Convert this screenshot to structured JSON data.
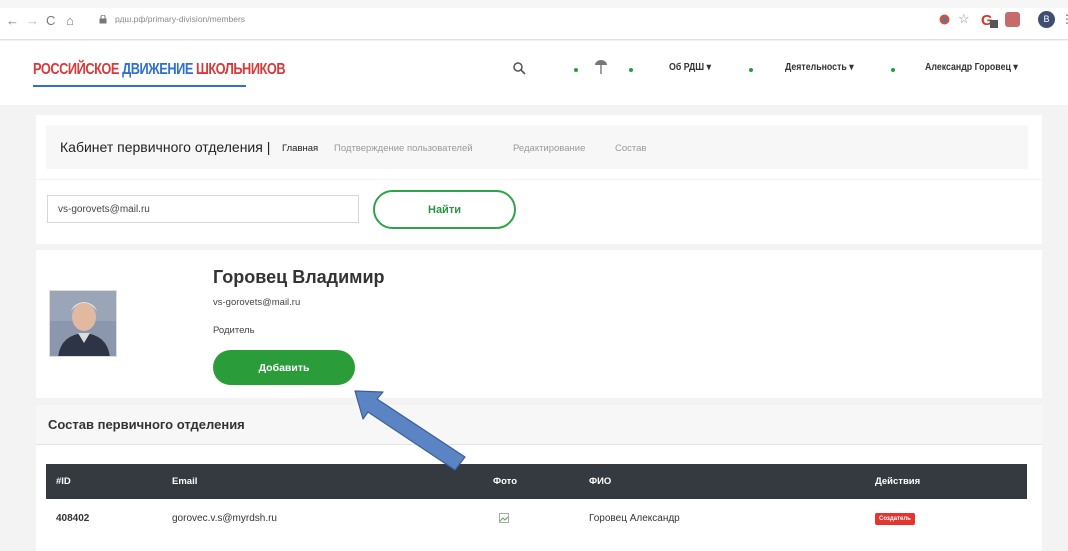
{
  "browser": {
    "url": "рдш.рф/primary-division/members",
    "nav": {
      "back": "←",
      "forward": "→",
      "reload": "C",
      "home": "⌂"
    },
    "icons": [
      "lock-icon",
      "star-icon",
      "extension-icon",
      "profile-icon"
    ],
    "profile_initial": "В"
  },
  "site": {
    "logo": {
      "word1": "РОССИЙСКОЕ",
      "word2": "ДВИЖЕНИЕ",
      "word3": "ШКОЛЬНИКОВ"
    },
    "menu": {
      "about": "Об РДШ ▾",
      "activity": "Деятельность ▾",
      "user": "Александр Горовец ▾"
    },
    "colors": {
      "logo_red": "#d63a3a",
      "logo_blue": "#2e6fd0",
      "brand_green": "#2a9d3a",
      "table_head": "#343a40",
      "badge_red": "#e3342f"
    }
  },
  "cabinet": {
    "title": "Кабинет первичного отделения |",
    "tabs": [
      {
        "label": "Главная",
        "active": true
      },
      {
        "label": "Подтверждение пользователей",
        "active": false
      },
      {
        "label": "Редактирование",
        "active": false
      },
      {
        "label": "Состав",
        "active": false
      }
    ]
  },
  "search": {
    "value": "vs-gorovets@mail.ru",
    "button_label": "Найти"
  },
  "user_card": {
    "name": "Горовец Владимир",
    "email": "vs-gorovets@mail.ru",
    "role": "Родитель",
    "add_label": "Добавить"
  },
  "members": {
    "title": "Состав первичного отделения",
    "columns": [
      "#ID",
      "Email",
      "Фото",
      "ФИО",
      "Действия"
    ],
    "rows": [
      {
        "id": "408402",
        "email": "gorovec.v.s@myrdsh.ru",
        "photo": "broken-image-icon",
        "fio": "Горовец Александр",
        "action": "Создатель"
      }
    ]
  }
}
